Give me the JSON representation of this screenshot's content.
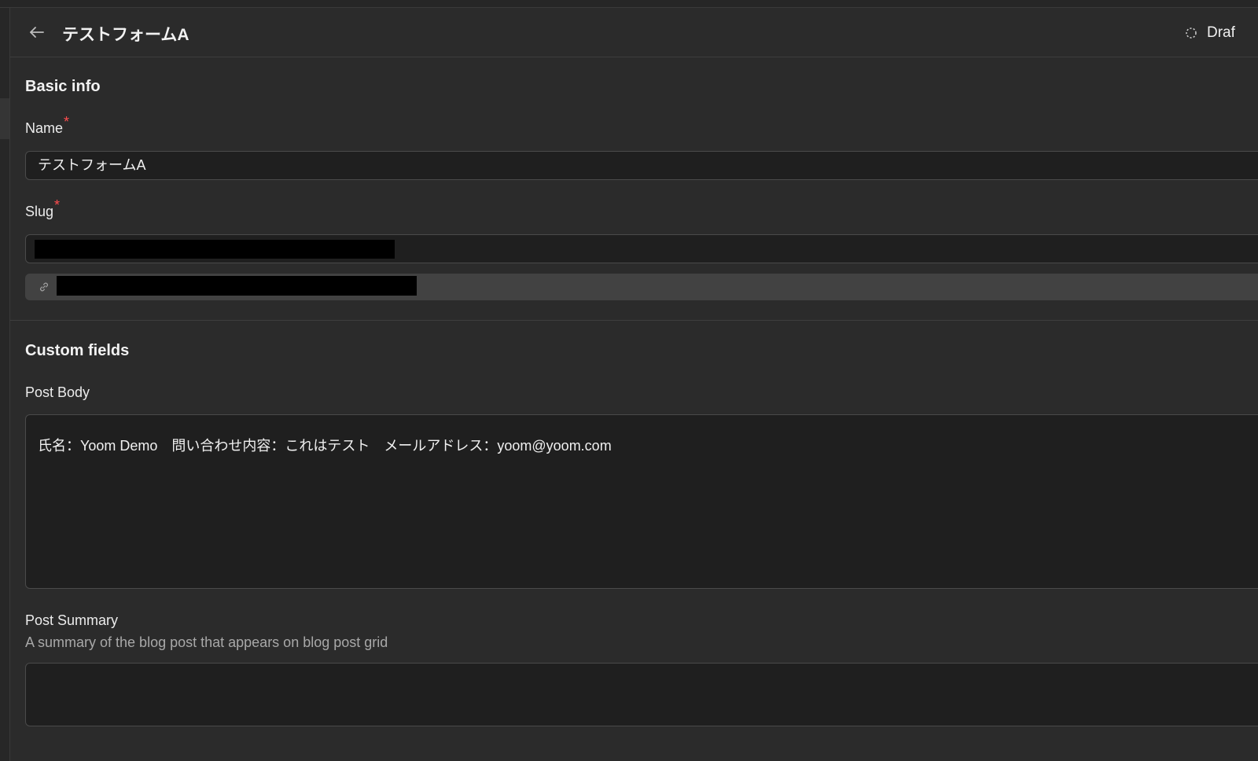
{
  "header": {
    "title": "テストフォームA",
    "status": "Draf"
  },
  "basic_info": {
    "title": "Basic info",
    "name_label": "Name",
    "name_value": "テストフォームA",
    "slug_label": "Slug",
    "required_mark": "*"
  },
  "custom_fields": {
    "title": "Custom fields",
    "post_body_label": "Post Body",
    "post_body_value": "氏名：Yoom Demo　問い合わせ内容：これはテスト　メールアドレス：yoom@yoom.com",
    "post_summary_label": "Post Summary",
    "post_summary_hint": "A summary of the blog post that appears on blog post grid",
    "post_summary_value": ""
  },
  "icons": {
    "back": "arrow-left-icon",
    "status": "dashed-circle-icon",
    "link": "link-icon"
  },
  "colors": {
    "background": "#2b2b2b",
    "input_bg": "#1f1f1f",
    "required": "#ff4d4f"
  }
}
